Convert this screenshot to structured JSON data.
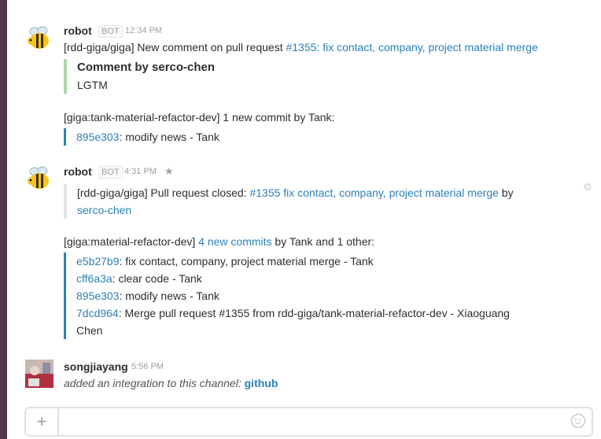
{
  "messages": [
    {
      "author": "robot",
      "bot_badge": "BOT",
      "time": "12:34 PM",
      "pr_prefix": "[rdd-giga/giga] New comment on pull request ",
      "pr_link": "#1355: fix contact, company, project material merge",
      "comment_title": "Comment by serco-chen",
      "comment_body": "LGTM",
      "commit_header": "[giga:tank-material-refactor-dev] 1 new commit by Tank:",
      "commits": [
        {
          "hash": "895e303",
          "text": ": modify news - Tank"
        }
      ]
    },
    {
      "author": "robot",
      "bot_badge": "BOT",
      "time": "4:31 PM",
      "closed_prefix": "[rdd-giga/giga] Pull request closed: ",
      "closed_link": "#1355 fix contact, company, project material merge",
      "closed_by": " by",
      "closed_user": "serco-chen",
      "commit_header_prefix": "[giga:material-refactor-dev] ",
      "commit_header_link": "4 new commits",
      "commit_header_suffix": " by Tank and 1 other:",
      "commits": [
        {
          "hash": "e5b27b9",
          "text": ": fix contact, company, project material merge - Tank"
        },
        {
          "hash": "cff6a3a",
          "text": ": clear code - Tank"
        },
        {
          "hash": "895e303",
          "text": ": modify news - Tank"
        },
        {
          "hash": "7dcd964",
          "text": ": Merge pull request #1355 from rdd-giga/tank-material-refactor-dev - Xiaoguang"
        }
      ],
      "wrap_text": "Chen"
    },
    {
      "author": "songjiayang",
      "time": "5:56 PM",
      "action_text": "added an integration to this channel: ",
      "action_link": "github"
    }
  ],
  "composer": {
    "plus_label": "+",
    "placeholder": ""
  },
  "colors": {
    "sidebar": "#4d394b",
    "link": "#2a80b9",
    "quote_green": "#a8d8a8",
    "quote_gray": "#e3e4e6"
  },
  "icons": [
    "bee-avatar",
    "star-icon",
    "gear-icon",
    "plus-icon",
    "emoji-icon"
  ]
}
